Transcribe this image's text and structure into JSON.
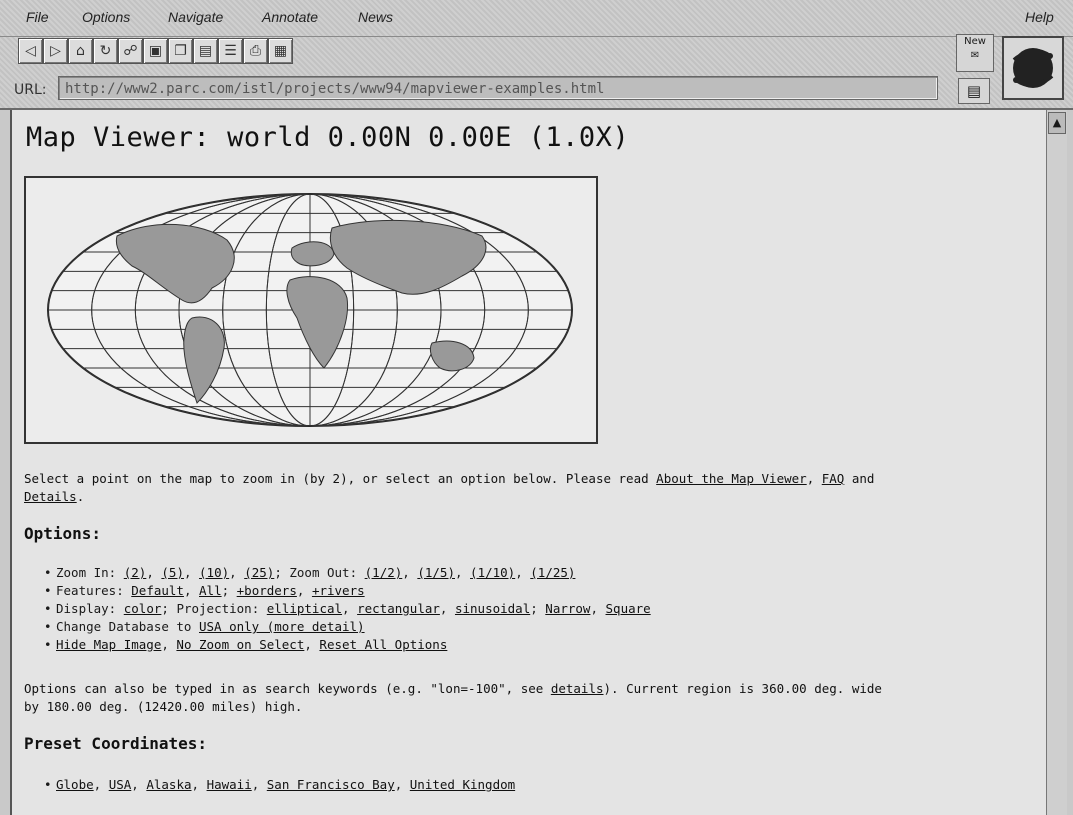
{
  "menu": {
    "file": "File",
    "options": "Options",
    "navigate": "Navigate",
    "annotate": "Annotate",
    "news": "News",
    "help": "Help"
  },
  "toolbar_icons": [
    "back-icon",
    "forward-icon",
    "home-icon",
    "reload-icon",
    "open-icon",
    "save-icon",
    "clone-icon",
    "print-icon",
    "document-icon",
    "close-window-icon",
    "hotlist-icon"
  ],
  "url": {
    "label": "URL:",
    "value": "http://www2.parc.com/istl/projects/www94/mapviewer-examples.html"
  },
  "news_box": "New",
  "page": {
    "title": "Map Viewer: world 0.00N 0.00E (1.0X)",
    "intro_prefix": "Select a point on the map to zoom in (by 2), or select an option below. Please read",
    "link_about": "About the Map Viewer",
    "link_faq": "FAQ",
    "and": "and",
    "link_details": "Details",
    "period": ".",
    "options_heading": "Options:",
    "zoom_in_label": "Zoom In:",
    "zoom_in": [
      "(2)",
      "(5)",
      "(10)",
      "(25)"
    ],
    "zoom_out_label": "Zoom Out:",
    "zoom_out": [
      "(1/2)",
      "(1/5)",
      "(1/10)",
      "(1/25)"
    ],
    "features_label": "Features:",
    "feat_default": "Default",
    "feat_all": "All",
    "feat_borders": "+borders",
    "feat_rivers": "+rivers",
    "display_label": "Display:",
    "display_color": "color",
    "projection_label": "Projection:",
    "proj_elliptical": "elliptical",
    "proj_rectangular": "rectangular",
    "proj_sinusoidal": "sinusoidal",
    "proj_narrow": "Narrow",
    "proj_square": "Square",
    "change_db_label": "Change Database to",
    "change_db_link": "USA only (more detail)",
    "hide_map": "Hide Map Image",
    "no_zoom": "No Zoom on Select",
    "reset_all": "Reset All Options",
    "typed_1_prefix": "Options can also be typed in as search keywords (e.g. \"lon=-100\", see",
    "typed_1_link": "details",
    "typed_1_suffix": "). Current region is 360.00 deg. wide",
    "typed_2": "by 180.00 deg. (12420.00 miles) high.",
    "preset_heading": "Preset Coordinates:",
    "presets": [
      "Globe",
      "USA",
      "Alaska",
      "Hawaii",
      "San Francisco Bay",
      "United Kingdom"
    ]
  }
}
